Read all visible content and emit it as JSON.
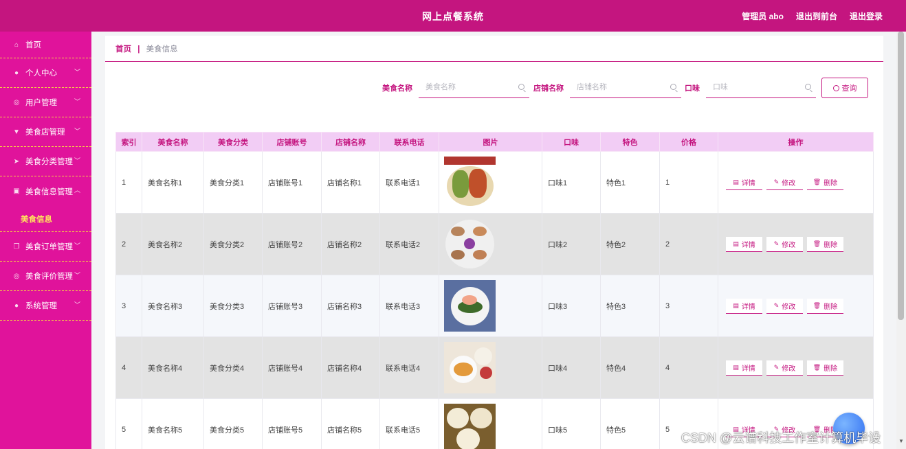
{
  "header": {
    "title": "网上点餐系统",
    "admin": "管理员 abo",
    "to_front": "退出到前台",
    "logout": "退出登录"
  },
  "sidebar": {
    "items": [
      {
        "label": "首页",
        "icon": "home-icon"
      },
      {
        "label": "个人中心",
        "icon": "user-icon"
      },
      {
        "label": "用户管理",
        "icon": "compass-icon"
      },
      {
        "label": "美食店管理",
        "icon": "cup-icon"
      },
      {
        "label": "美食分类管理",
        "icon": "send-icon"
      },
      {
        "label": "美食信息管理",
        "icon": "clipboard-icon",
        "expanded": true
      },
      {
        "label": "美食订单管理",
        "icon": "copy-icon"
      },
      {
        "label": "美食评价管理",
        "icon": "compass-icon"
      },
      {
        "label": "系统管理",
        "icon": "user-icon"
      }
    ],
    "sub_item": "美食信息"
  },
  "breadcrumb": {
    "home": "首页",
    "separator": "|",
    "current": "美食信息"
  },
  "search": {
    "name_label": "美食名称",
    "name_placeholder": "美食名称",
    "shop_label": "店铺名称",
    "shop_placeholder": "店铺名称",
    "taste_label": "口味",
    "taste_placeholder": "口味",
    "query_button": "查询"
  },
  "table": {
    "headers": [
      "索引",
      "美食名称",
      "美食分类",
      "店铺账号",
      "店铺名称",
      "联系电话",
      "图片",
      "口味",
      "特色",
      "价格",
      "操作"
    ],
    "rows": [
      {
        "index": "1",
        "name": "美食名称1",
        "category": "美食分类1",
        "shop_account": "店铺账号1",
        "shop_name": "店铺名称1",
        "phone": "联系电话1",
        "taste": "口味1",
        "feature": "特色1",
        "price": "1"
      },
      {
        "index": "2",
        "name": "美食名称2",
        "category": "美食分类2",
        "shop_account": "店铺账号2",
        "shop_name": "店铺名称2",
        "phone": "联系电话2",
        "taste": "口味2",
        "feature": "特色2",
        "price": "2"
      },
      {
        "index": "3",
        "name": "美食名称3",
        "category": "美食分类3",
        "shop_account": "店铺账号3",
        "shop_name": "店铺名称3",
        "phone": "联系电话3",
        "taste": "口味3",
        "feature": "特色3",
        "price": "3"
      },
      {
        "index": "4",
        "name": "美食名称4",
        "category": "美食分类4",
        "shop_account": "店铺账号4",
        "shop_name": "店铺名称4",
        "phone": "联系电话4",
        "taste": "口味4",
        "feature": "特色4",
        "price": "4"
      },
      {
        "index": "5",
        "name": "美食名称5",
        "category": "美食分类5",
        "shop_account": "店铺账号5",
        "shop_name": "店铺名称5",
        "phone": "联系电话5",
        "taste": "口味5",
        "feature": "特色5",
        "price": "5"
      }
    ],
    "actions": {
      "detail": "详情",
      "edit": "修改",
      "delete": "删除"
    }
  },
  "watermark": "CSDN @云谱科技工作室计算机毕设",
  "colors": {
    "primary": "#c4157f",
    "sidebar": "#e0139b",
    "accent": "#f5d442",
    "header_row": "#f2cdf5"
  }
}
